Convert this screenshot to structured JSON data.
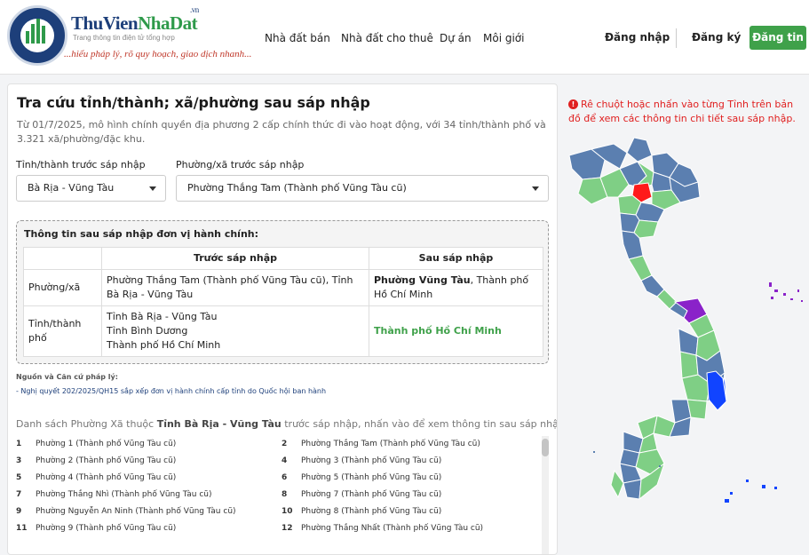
{
  "header": {
    "brand_a": "ThuVien",
    "brand_b": "NhaDat",
    "brand_suffix": ".vn",
    "brand_sub": "Trang thông tin điện tử tổng hợp",
    "slogan": "...hiểu pháp lý, rõ quy hoạch, giao dịch nhanh...",
    "nav": [
      "Nhà đất bán",
      "Nhà đất cho thuê",
      "Dự án",
      "Môi giới"
    ],
    "login": "Đăng nhập",
    "register": "Đăng ký",
    "post_button": "Đăng tin"
  },
  "lookup": {
    "title": "Tra cứu tỉnh/thành; xã/phường sau sáp nhập",
    "description": "Từ 01/7/2025, mô hình chính quyền địa phương 2 cấp chính thức đi vào hoạt động, với 34 tỉnh/thành phố và 3.321 xã/phường/đặc khu.",
    "province_label": "Tỉnh/thành trước sáp nhập",
    "province_value": "Bà Rịa - Vũng Tàu",
    "ward_label": "Phường/xã trước sáp nhập",
    "ward_value": "Phường Thắng Tam (Thành phố Vũng Tàu cũ)"
  },
  "info": {
    "title": "Thông tin sau sáp nhập đơn vị hành chính:",
    "col_before": "Trước sáp nhập",
    "col_after": "Sau sáp nhập",
    "row1_label": "Phường/xã",
    "row1_before": "Phường Thắng Tam (Thành phố Vũng Tàu cũ), Tỉnh Bà Rịa - Vũng Tàu",
    "row1_after_bold": "Phường Vũng Tàu",
    "row1_after_rest": ", Thành phố Hồ Chí Minh",
    "row2_label": "Tỉnh/thành phố",
    "row2_before": [
      "Tỉnh Bà Rịa - Vũng Tàu",
      "Tỉnh Bình Dương",
      "Thành phố Hồ Chí Minh"
    ],
    "row2_after": "Thành phố Hồ Chí Minh"
  },
  "source": {
    "title": "Nguồn và Căn cứ pháp lý:",
    "link": "- Nghị quyết 202/2025/QH15 sắp xếp đơn vị hành chính cấp tỉnh do Quốc hội ban hành"
  },
  "ward_list": {
    "title_pre": "Danh sách Phường Xã thuộc ",
    "title_bold": "Tỉnh Bà Rịa - Vũng Tàu",
    "title_post": " trước sáp nhập, nhấn vào để xem thông tin sau sáp nhập",
    "items": [
      {
        "n": "1",
        "name": "Phường 1 (Thành phố Vũng Tàu cũ)"
      },
      {
        "n": "2",
        "name": "Phường Thắng Tam (Thành phố Vũng Tàu cũ)"
      },
      {
        "n": "3",
        "name": "Phường 2 (Thành phố Vũng Tàu cũ)"
      },
      {
        "n": "4",
        "name": "Phường 3 (Thành phố Vũng Tàu cũ)"
      },
      {
        "n": "5",
        "name": "Phường 4 (Thành phố Vũng Tàu cũ)"
      },
      {
        "n": "6",
        "name": "Phường 5 (Thành phố Vũng Tàu cũ)"
      },
      {
        "n": "7",
        "name": "Phường Thắng Nhì (Thành phố Vũng Tàu cũ)"
      },
      {
        "n": "8",
        "name": "Phường 7 (Thành phố Vũng Tàu cũ)"
      },
      {
        "n": "9",
        "name": "Phường Nguyễn An Ninh (Thành phố Vũng Tàu cũ)"
      },
      {
        "n": "10",
        "name": "Phường 8 (Thành phố Vũng Tàu cũ)"
      },
      {
        "n": "11",
        "name": "Phường 9 (Thành phố Vũng Tàu cũ)"
      },
      {
        "n": "12",
        "name": "Phường Thắng Nhất (Thành phố Vũng Tàu cũ)"
      }
    ]
  },
  "map": {
    "note": "Rê chuột hoặc nhấn vào từng Tỉnh trên bản đồ để xem các thông tin chi tiết sau sáp nhập.",
    "colors": {
      "blue": "#5b7fb0",
      "green": "#7fcf85",
      "red": "#ff1a1a",
      "purple": "#8a22c9",
      "bright_blue": "#1144ff"
    }
  }
}
